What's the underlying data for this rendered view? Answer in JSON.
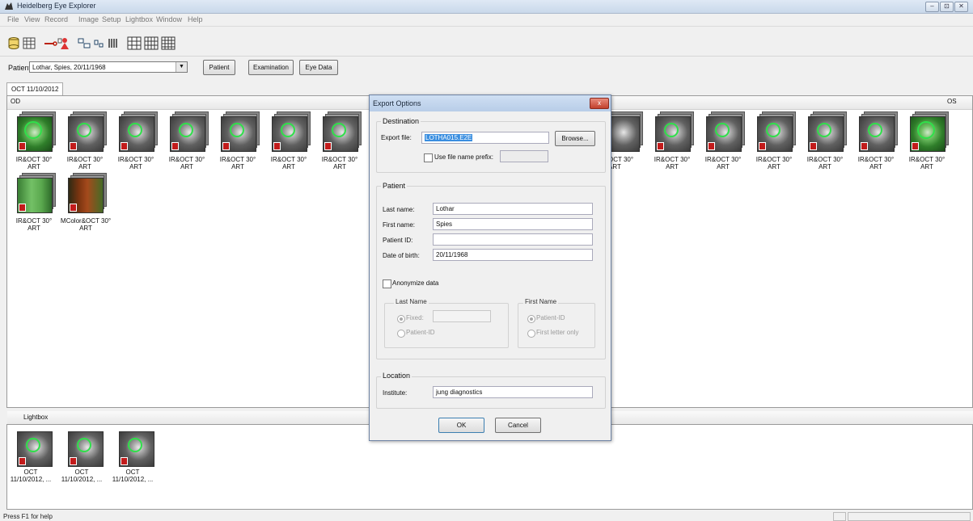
{
  "window": {
    "title": "Heidelberg Eye Explorer",
    "minimize": "–",
    "maximize": "⊡",
    "close": "✕"
  },
  "menu": [
    "File",
    "View",
    "Record",
    "Image",
    "Setup",
    "Lightbox",
    "Window",
    "Help"
  ],
  "patient_bar": {
    "label": "Patient:",
    "value": "Lothar, Spies, 20/11/1968",
    "buttons": [
      "Patient",
      "Examination",
      "Eye Data"
    ]
  },
  "exam_tab": "OCT 11/10/2012",
  "sections": {
    "od": "OD",
    "os": "OS",
    "lightbox": "Lightbox"
  },
  "od_thumbs": [
    {
      "caption": "IR&OCT 30°\nART"
    },
    {
      "caption": "IR&OCT 30°\nART"
    },
    {
      "caption": "IR&OCT 30°\nART"
    },
    {
      "caption": "IR&OCT 30°\nART"
    },
    {
      "caption": "IR&OCT 30°\nART"
    },
    {
      "caption": "IR&OCT 30°\nART"
    },
    {
      "caption": "IR&OCT 30°\nART"
    }
  ],
  "od_thumbs_row2": [
    {
      "caption": "IR&OCT 30°\nART"
    },
    {
      "caption": "MColor&OCT 30°\nART"
    }
  ],
  "os_thumbs": [
    {
      "caption": "OCT 30°\nART"
    },
    {
      "caption": "IR&OCT 30°\nART"
    },
    {
      "caption": "IR&OCT 30°\nART"
    },
    {
      "caption": "IR&OCT 30°\nART"
    },
    {
      "caption": "IR&OCT 30°\nART"
    },
    {
      "caption": "IR&OCT 30°\nART"
    },
    {
      "caption": "IR&OCT 30°\nART"
    }
  ],
  "lightbox_thumbs": [
    {
      "caption": "OCT\n11/10/2012, ..."
    },
    {
      "caption": "OCT\n11/10/2012, ..."
    },
    {
      "caption": "OCT\n11/10/2012, ..."
    }
  ],
  "status": "Press F1 for help",
  "dialog": {
    "title": "Export Options",
    "close": "x",
    "destination": {
      "group": "Destination",
      "export_label": "Export file:",
      "export_value": "LOTHA015.E2E",
      "browse": "Browse...",
      "prefix_label": "Use file name prefix:",
      "prefix_value": ""
    },
    "patient": {
      "group": "Patient",
      "last_name_label": "Last name:",
      "last_name": "Lothar",
      "first_name_label": "First name:",
      "first_name": "Spies",
      "patient_id_label": "Patient ID:",
      "patient_id": "",
      "dob_label": "Date of birth:",
      "dob": "20/11/1968",
      "anonymize": "Anonymize data",
      "last_name_group": "Last Name",
      "fixed": "Fixed:",
      "fixed_value": "",
      "patient_id_opt": "Patient-ID",
      "first_name_group": "First Name",
      "first_patient_id_opt": "Patient-ID",
      "first_letter_only": "First letter only"
    },
    "location": {
      "group": "Location",
      "institute_label": "Institute:",
      "institute": "jung diagnostics"
    },
    "ok": "OK",
    "cancel": "Cancel"
  }
}
